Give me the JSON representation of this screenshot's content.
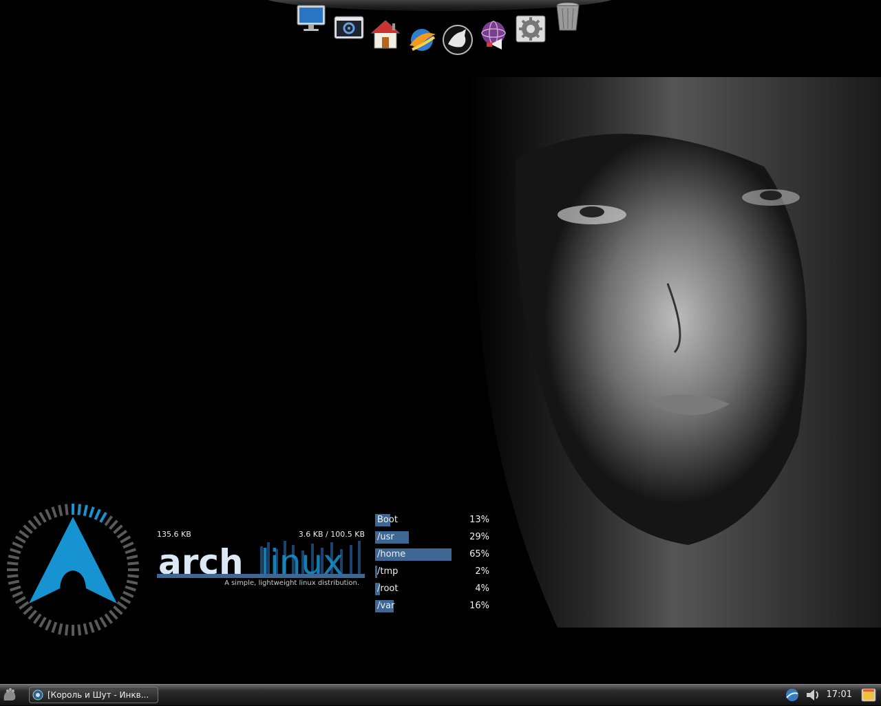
{
  "dock": {
    "items": [
      {
        "name": "monitor-icon"
      },
      {
        "name": "system-settings-icon"
      },
      {
        "name": "home-folder-icon"
      },
      {
        "name": "browser-icon"
      },
      {
        "name": "media-player-icon"
      },
      {
        "name": "messenger-icon"
      },
      {
        "name": "preferences-icon"
      },
      {
        "name": "trash-icon"
      }
    ]
  },
  "network": {
    "left_value": "135.6 KB",
    "right_value": "3.6 KB / 100.5 KB"
  },
  "arch": {
    "logo_text_a": "arch",
    "logo_text_b": "linux",
    "tagline": "A simple, lightweight linux distribution."
  },
  "disks": [
    {
      "label": "Boot",
      "percent": "13%",
      "fill": 0.13
    },
    {
      "label": "/usr",
      "percent": "29%",
      "fill": 0.29
    },
    {
      "label": "/home",
      "percent": "65%",
      "fill": 0.65
    },
    {
      "label": "/tmp",
      "percent": "2%",
      "fill": 0.02
    },
    {
      "label": "/root",
      "percent": "4%",
      "fill": 0.04
    },
    {
      "label": "/var",
      "percent": "16%",
      "fill": 0.16
    }
  ],
  "panel": {
    "task_title": "[Король и Шут - Инкв...",
    "clock": "17:01"
  },
  "colors": {
    "accent": "#3f6796",
    "arch_blue": "#1793d1"
  }
}
